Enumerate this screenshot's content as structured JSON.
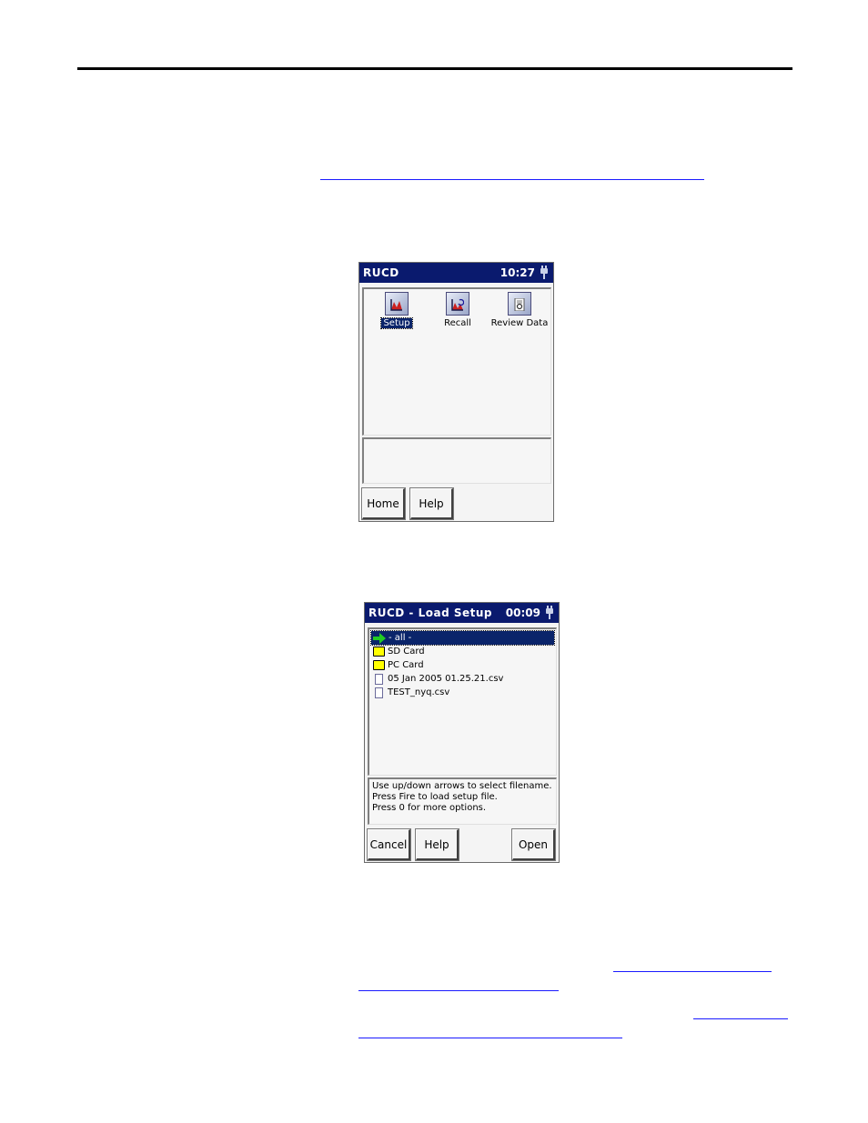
{
  "screen1": {
    "title": "RUCD",
    "time": "10:27",
    "icons": [
      {
        "label": "Setup",
        "icon": "setup-chart-icon",
        "selected": true
      },
      {
        "label": "Recall",
        "icon": "recall-chart-icon",
        "selected": false
      },
      {
        "label": "Review Data",
        "icon": "review-data-icon",
        "selected": false
      }
    ],
    "buttons": {
      "home": "Home",
      "help": "Help"
    }
  },
  "screen2": {
    "title": "RUCD - Load Setup",
    "time": "00:09",
    "files": [
      {
        "name": "- all -",
        "icon": "green-arrow-icon",
        "selected": true
      },
      {
        "name": "SD Card",
        "icon": "folder-icon",
        "selected": false
      },
      {
        "name": "PC Card",
        "icon": "folder-icon",
        "selected": false
      },
      {
        "name": "05 Jan 2005 01.25.21.csv",
        "icon": "file-icon",
        "selected": false
      },
      {
        "name": "TEST_nyq.csv",
        "icon": "file-icon",
        "selected": false
      }
    ],
    "message": [
      "Use up/down arrows to select filename.",
      "Press Fire to load setup file.",
      "Press 0 for more options."
    ],
    "buttons": {
      "cancel": "Cancel",
      "help": "Help",
      "open": "Open"
    }
  },
  "colors": {
    "titlebar": "#0a1a6e",
    "selection": "#0a246a",
    "folder": "#ffff00",
    "arrow": "#22cc22",
    "link": "#1a1aff"
  }
}
